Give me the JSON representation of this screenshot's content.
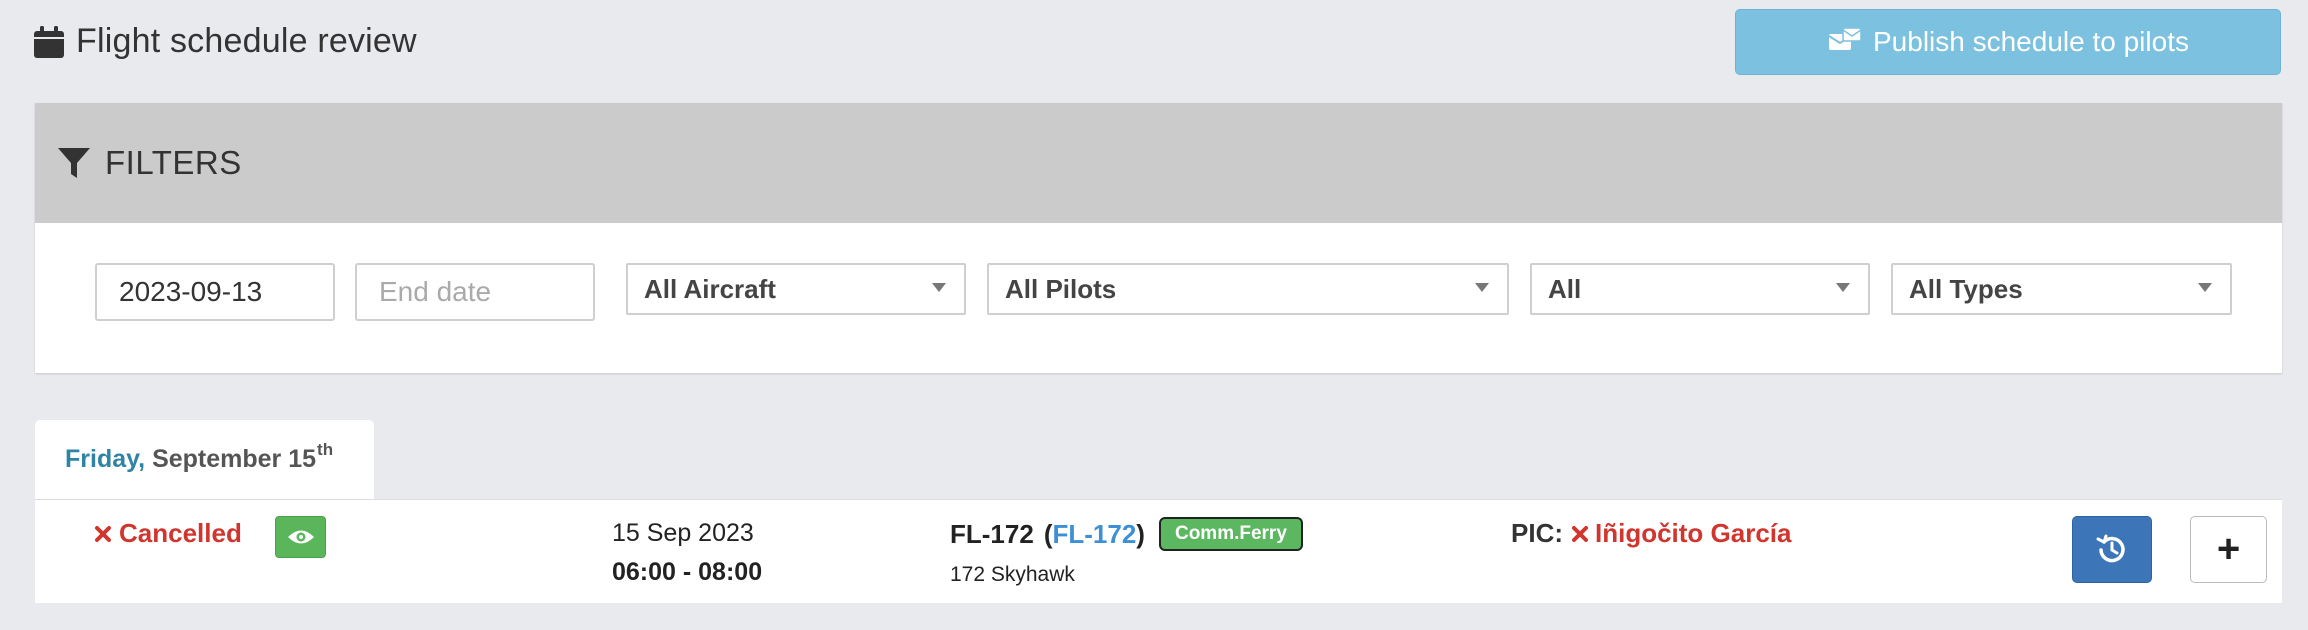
{
  "header": {
    "title": "Flight schedule review",
    "icon": "calendar-icon"
  },
  "publish": {
    "label": "Publish schedule to pilots",
    "icon": "send-mail-icon",
    "color": "#7cc1e0"
  },
  "filters": {
    "title": "FILTERS",
    "start_date": "2023-09-13",
    "end_date_placeholder": "End date",
    "aircraft": "All Aircraft",
    "pilots": "All Pilots",
    "status": "All",
    "types": "All Types"
  },
  "day": {
    "weekday": "Friday,",
    "date": "September 15",
    "suffix": "th"
  },
  "flight": {
    "status": "Cancelled",
    "date": "15 Sep 2023",
    "time": "06:00 - 08:00",
    "code": "FL-172",
    "code_link": "FL-172",
    "badge": "Comm.Ferry",
    "aircraft": "172 Skyhawk",
    "pic_label": "PIC:",
    "pic_name": "Iñigočito García"
  },
  "actions": {
    "plus": "+"
  },
  "colors": {
    "accent": "#3c76b8",
    "danger": "#d0352e",
    "success": "#5cb860",
    "link": "#3d8fd6"
  }
}
